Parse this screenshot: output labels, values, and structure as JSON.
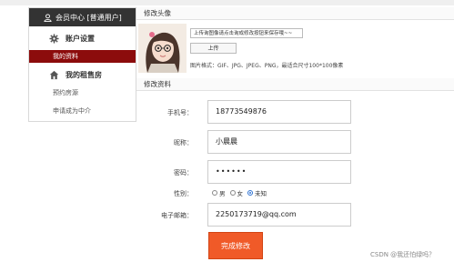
{
  "sidebar": {
    "header": "会员中心 [普通用户]",
    "sections": [
      {
        "title": "账户设置",
        "icon": "gear-icon",
        "items": [
          {
            "label": "我的资料",
            "active": true
          }
        ]
      },
      {
        "title": "我的租售房",
        "icon": "house-icon",
        "items": [
          {
            "label": "预约房源",
            "active": false
          },
          {
            "label": "申请成为中介",
            "active": false
          }
        ]
      }
    ]
  },
  "avatar_section": {
    "title": "修改头像",
    "upload_hint": "上传询图像请点击询成修改按钮来保存哦~~",
    "upload_button": "上传",
    "format_note": "图片格式：GIF、JPG、JPEG、PNG，最适合尺寸100*100像素"
  },
  "profile_section": {
    "title": "修改资料",
    "fields": {
      "phone": {
        "label": "手机号：",
        "value": "18773549876"
      },
      "nickname": {
        "label": "昵称：",
        "value": "小晨晨"
      },
      "password": {
        "label": "密码：",
        "value": "••••••"
      },
      "gender": {
        "label": "性别：",
        "options": [
          "男",
          "女",
          "未知"
        ],
        "selected": "未知"
      },
      "email": {
        "label": "电子邮箱：",
        "value": "2250173719@qq.com"
      }
    },
    "submit_label": "完成修改"
  },
  "watermark": "CSDN @我还怕绿吗？",
  "colors": {
    "sidebar_header": "#333333",
    "active_item": "#8c0c0c",
    "submit": "#f05a28",
    "radio_selected": "#2e72d2"
  }
}
